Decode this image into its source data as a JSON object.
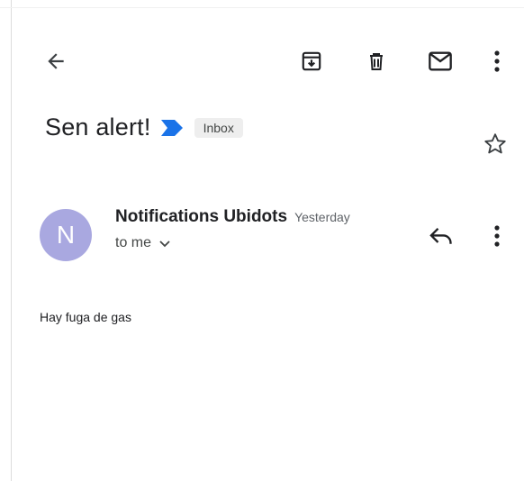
{
  "toolbar": {
    "back_icon": "arrow-back-icon",
    "archive_icon": "archive-icon",
    "delete_icon": "trash-icon",
    "mark_unread_icon": "mail-icon",
    "more_icon": "more-vert-icon"
  },
  "email": {
    "subject": "Sen alert!",
    "importance_icon": "importance-marker-icon",
    "importance_color": "#1a73e8",
    "label": "Inbox",
    "star_icon": "star-outline-icon",
    "sender": {
      "avatar_letter": "N",
      "avatar_color": "#a9a8e0",
      "name": "Notifications Ubidots",
      "time": "Yesterday",
      "recipient": "to me"
    },
    "reply_icon": "reply-icon",
    "body": "Hay fuga de gas"
  }
}
